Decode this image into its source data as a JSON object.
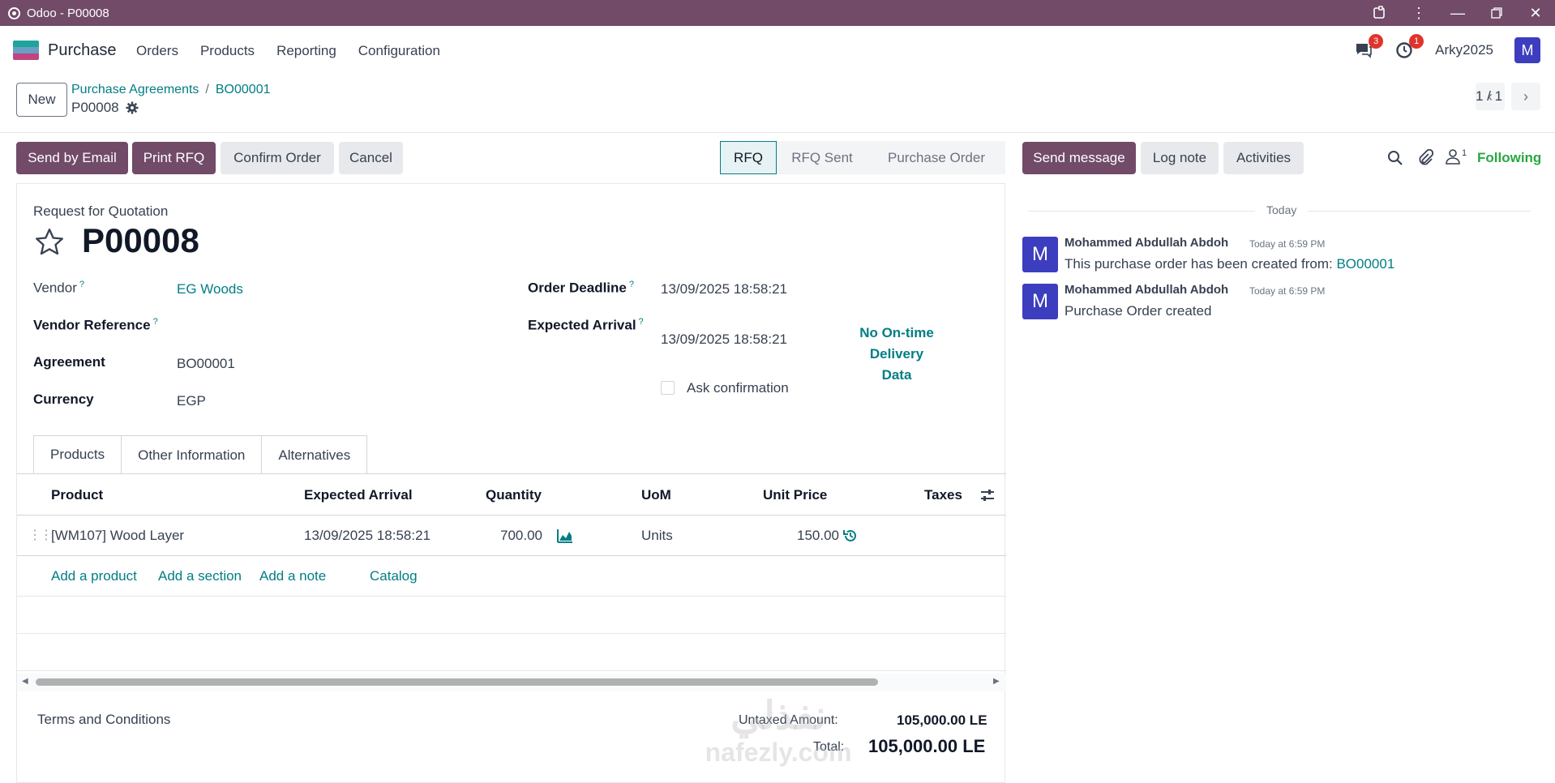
{
  "window": {
    "title": "Odoo - P00008"
  },
  "nav": {
    "app_name": "Purchase",
    "menu": [
      "Orders",
      "Products",
      "Reporting",
      "Configuration"
    ],
    "messages_count": "3",
    "activities_count": "1",
    "company": "Arky2025",
    "avatar_letter": "M"
  },
  "control": {
    "new_label": "New",
    "breadcrumb": [
      "Purchase Agreements",
      "BO00001"
    ],
    "record_name": "P00008",
    "pager": "1 / 1"
  },
  "actions": {
    "send_email": "Send by Email",
    "print_rfq": "Print RFQ",
    "confirm": "Confirm Order",
    "cancel": "Cancel"
  },
  "stages": [
    "RFQ",
    "RFQ Sent",
    "Purchase Order"
  ],
  "form": {
    "subtitle": "Request for Quotation",
    "name": "P00008",
    "vendor_label": "Vendor",
    "vendor": "EG Woods",
    "vendor_ref_label": "Vendor Reference",
    "agreement_label": "Agreement",
    "agreement": "BO00001",
    "currency_label": "Currency",
    "currency": "EGP",
    "deadline_label": "Order Deadline",
    "deadline": "13/09/2025 18:58:21",
    "arrival_label": "Expected Arrival",
    "arrival": "13/09/2025 18:58:21",
    "on_time_line1": "No On-time Delivery",
    "on_time_line2": "Data",
    "ask_confirmation": "Ask confirmation",
    "help_mark": "?"
  },
  "tabs": [
    "Products",
    "Other Information",
    "Alternatives"
  ],
  "lines": {
    "headers": [
      "Product",
      "Expected Arrival",
      "Quantity",
      "UoM",
      "Unit Price",
      "Taxes"
    ],
    "rows": [
      {
        "product": "[WM107] Wood Layer",
        "arrival": "13/09/2025 18:58:21",
        "qty": "700.00",
        "uom": "Units",
        "price": "150.00"
      }
    ],
    "add_product": "Add a product",
    "add_section": "Add a section",
    "add_note": "Add a note",
    "catalog": "Catalog"
  },
  "footer": {
    "terms": "Terms and Conditions",
    "untaxed_label": "Untaxed Amount:",
    "untaxed": "105,000.00 LE",
    "total_label": "Total:",
    "total": "105,000.00 LE"
  },
  "chatter": {
    "send_message": "Send message",
    "log_note": "Log note",
    "activities": "Activities",
    "followers_count": "1",
    "following": "Following",
    "date_sep": "Today",
    "messages": [
      {
        "avatar": "M",
        "author": "Mohammed Abdullah Abdoh",
        "time": "Today at 6:59 PM",
        "text": "This purchase order has been created from: ",
        "link": "BO00001"
      },
      {
        "avatar": "M",
        "author": "Mohammed Abdullah Abdoh",
        "time": "Today at 6:59 PM",
        "text": "Purchase Order created",
        "link": ""
      }
    ]
  },
  "watermark": {
    "arabic": "نفذلي",
    "latin": "nafezly.com"
  },
  "colors": {
    "brand": "#714B67",
    "link": "#017e84",
    "following": "#28a745"
  }
}
